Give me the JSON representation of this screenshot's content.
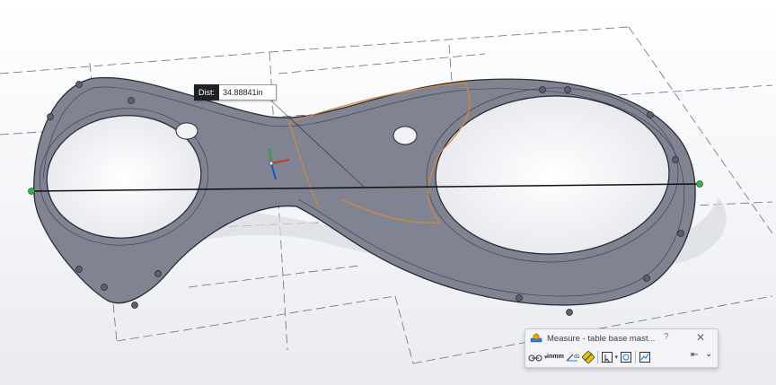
{
  "measurement": {
    "dist_label": "Dist:",
    "dist_value": "34.88841in",
    "endpoint_color": "#37b24d",
    "line_color": "#111111"
  },
  "part": {
    "face_color": "#7f8392",
    "edge_color": "#2b2d33",
    "highlight_edge_color": "#d4883d"
  },
  "measure_panel": {
    "title": "Measure - table base mast...",
    "help_label": "?",
    "close_label": "✕",
    "units_label_top": "in",
    "units_label_bottom": "mm",
    "toolbar_icons": [
      "arc-center-icon",
      "units-precision-icon",
      "show-xyz-icon",
      "point-to-point-icon",
      "projection-icon",
      "history-icon",
      "sensor-icon"
    ],
    "pin_label": "⇤",
    "expand_label": "⌄"
  }
}
